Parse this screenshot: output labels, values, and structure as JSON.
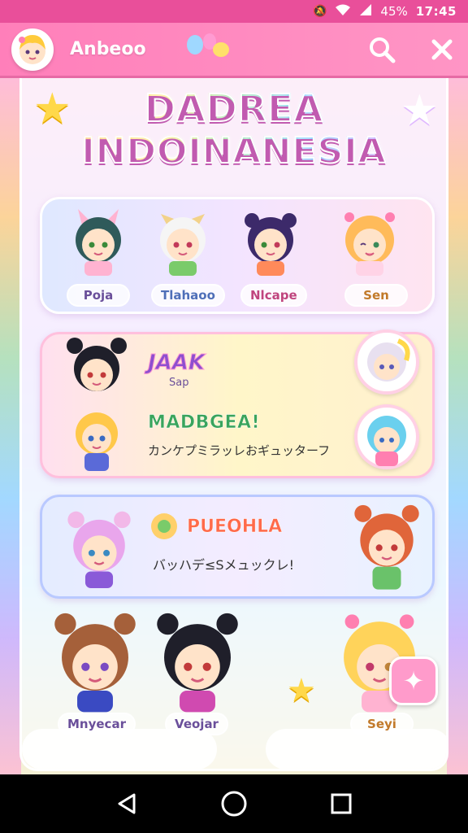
{
  "status_bar": {
    "signal_icons": "signal-mute-wifi-cellular",
    "battery": "45%",
    "time": "17:45"
  },
  "app_bar": {
    "title": "Anbeoo",
    "search_icon": "search-icon",
    "close_icon": "close-icon"
  },
  "banner": {
    "line1": "DADREA",
    "line2": "INDOINANESIA"
  },
  "card1": {
    "characters": [
      {
        "name": "Poja"
      },
      {
        "name": "Tlahaoo"
      },
      {
        "name": "Nlcape"
      },
      {
        "name": "Sen"
      }
    ]
  },
  "card2": {
    "title": "JAAK",
    "subtitle": "Sap",
    "heading": "MADBGEA!",
    "body": "カンケプミラッレおギュッターフ"
  },
  "card3": {
    "heading": "PUEOHLA",
    "body": "バッハデ≤Sメュックレ!"
  },
  "bottom_row": {
    "characters": [
      {
        "name": "Mnyecar"
      },
      {
        "name": "Veojar"
      },
      {
        "name": "Seyi"
      }
    ]
  },
  "nav": {
    "back": "back-icon",
    "home": "home-icon",
    "recents": "recents-icon"
  },
  "colors": {
    "accent": "#ff7fba",
    "status": "#e94f9a"
  }
}
